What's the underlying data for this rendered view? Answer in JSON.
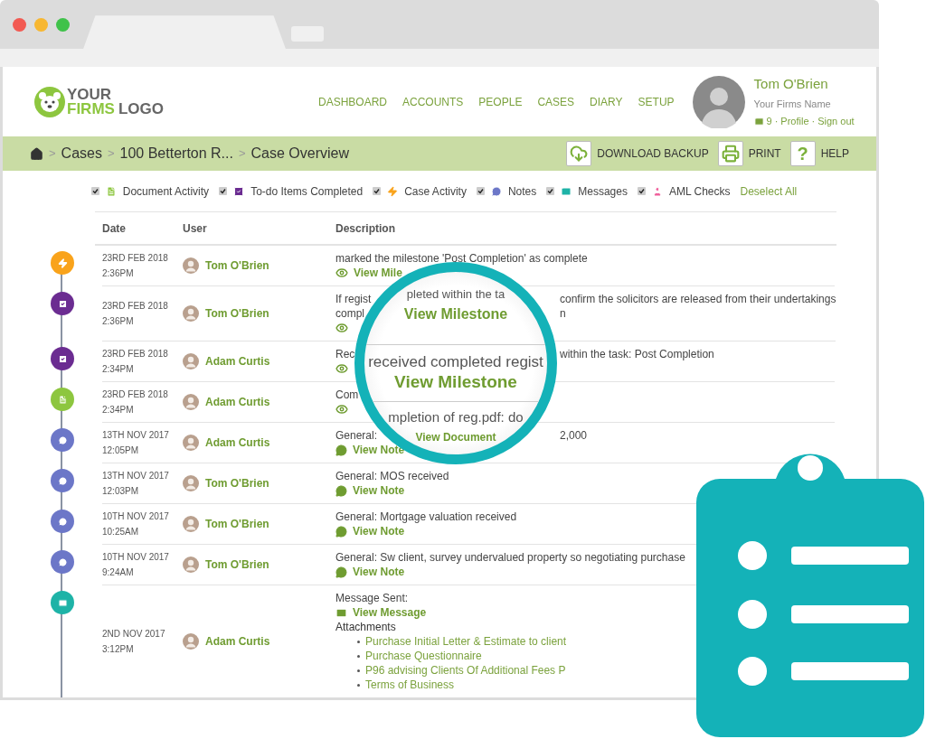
{
  "logo": {
    "line1": "YOUR",
    "line2a": "FIRMS",
    "line2b": "LOGO"
  },
  "nav": [
    "DASHBOARD",
    "ACCOUNTS",
    "PEOPLE",
    "CASES",
    "DIARY",
    "SETUP"
  ],
  "profile": {
    "name": "Tom O'Brien",
    "firm": "Your Firms Name",
    "messages": "9",
    "separator": "·",
    "links": [
      "Profile",
      "Sign out"
    ]
  },
  "breadcrumb": {
    "separator": ">",
    "items": [
      "Cases",
      "100 Betterton R...",
      "Case Overview"
    ]
  },
  "actions": [
    {
      "kind": "download",
      "label": "DOWNLOAD BACKUP"
    },
    {
      "kind": "print",
      "label": "PRINT"
    },
    {
      "kind": "help",
      "label": "HELP",
      "icon_text": "?"
    }
  ],
  "filters": [
    {
      "kind": "document",
      "label": "Document Activity",
      "checked": true
    },
    {
      "kind": "todo",
      "label": "To-do Items Completed",
      "checked": true
    },
    {
      "kind": "milestone",
      "label": "Case Activity",
      "checked": true
    },
    {
      "kind": "note",
      "label": "Notes",
      "checked": true
    },
    {
      "kind": "message",
      "label": "Messages",
      "checked": true
    },
    {
      "kind": "aml",
      "label": "AML Checks",
      "checked": true
    }
  ],
  "deselect_all": "Deselect All",
  "table": {
    "columns": [
      "Date",
      "User",
      "Description"
    ],
    "rows": [
      {
        "kind": "milestone",
        "date": "23RD FEB 2018",
        "time": "2:36PM",
        "user": "Tom O'Brien",
        "lines": [
          [
            "marked the milestone 'Post Completion' as complete"
          ]
        ],
        "link": "View Mile"
      },
      {
        "kind": "todo",
        "date": "23RD FEB 2018",
        "time": "2:36PM",
        "user": "Tom O'Brien",
        "lines": [
          [
            "If regist",
            "confirm the solicitors are released from their undertakings"
          ],
          [
            "compl",
            "n"
          ]
        ]
      },
      {
        "kind": "todo",
        "date": "23RD FEB 2018",
        "time": "2:34PM",
        "user": "Adam Curtis",
        "lines": [
          [
            "Rec",
            "within the task: Post Completion"
          ]
        ]
      },
      {
        "kind": "document",
        "date": "23RD FEB 2018",
        "time": "2:34PM",
        "user": "Adam Curtis",
        "lines": [
          [
            "Com"
          ]
        ]
      },
      {
        "kind": "note",
        "date": "13TH NOV 2017",
        "time": "12:05PM",
        "user": "Adam Curtis",
        "lines": [
          [
            "General:",
            "2,000"
          ]
        ],
        "link": "View Note"
      },
      {
        "kind": "note",
        "date": "13TH NOV 2017",
        "time": "12:03PM",
        "user": "Tom O'Brien",
        "lines": [
          [
            "General: MOS received"
          ]
        ],
        "link": "View Note"
      },
      {
        "kind": "note",
        "date": "10TH NOV 2017",
        "time": "10:25AM",
        "user": "Tom O'Brien",
        "lines": [
          [
            "General: Mortgage valuation received"
          ]
        ],
        "link": "View Note"
      },
      {
        "kind": "note",
        "date": "10TH NOV 2017",
        "time": "9:24AM",
        "user": "Tom O'Brien",
        "lines": [
          [
            "General: Sw client, survey undervalued property so negotiating purchase"
          ]
        ],
        "link": "View Note"
      },
      {
        "kind": "message",
        "date": "2ND NOV 2017",
        "time": "3:12PM",
        "user": "Adam Curtis",
        "lines": [
          [
            "Message Sent:"
          ]
        ],
        "link": "View Message",
        "attachments_title": "Attachments",
        "attachments": [
          "Purchase Initial Letter & Estimate to client",
          "Purchase Questionnaire",
          "P96 advising Clients Of Additional Fees P",
          "Terms of Business"
        ]
      }
    ]
  },
  "lens": [
    {
      "kind": "text",
      "text": "pleted within the ta"
    },
    {
      "kind": "link",
      "text": "View Milestone"
    },
    {
      "kind": "text",
      "text": "received completed regist"
    },
    {
      "kind": "link",
      "text": "View Milestone"
    },
    {
      "kind": "text",
      "text": "mpletion of reg.pdf: do"
    },
    {
      "kind": "link",
      "text": "View Document"
    }
  ]
}
